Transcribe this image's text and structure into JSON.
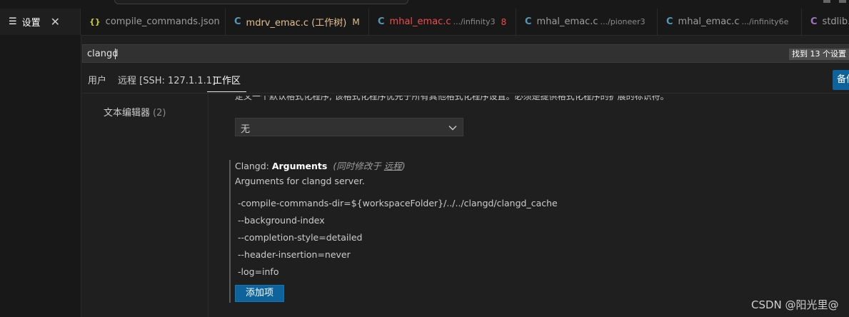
{
  "tabs": [
    {
      "icon": "{}",
      "icon_name": "json-file-icon",
      "label": "compile_commands.json",
      "desc": "",
      "badge": ""
    },
    {
      "icon": "C",
      "icon_name": "c-file-icon",
      "label": "mdrv_emac.c (工作树)",
      "desc": "",
      "badge": "M"
    },
    {
      "icon": "C",
      "icon_name": "c-file-icon",
      "label": "mhal_emac.c",
      "desc": ".../infinity3",
      "badge": "8"
    },
    {
      "icon": "C",
      "icon_name": "c-file-icon",
      "label": "mhal_emac.c",
      "desc": ".../pioneer3",
      "badge": ""
    },
    {
      "icon": "C",
      "icon_name": "c-file-icon",
      "label": "mhal_emac.c",
      "desc": ".../infinity6e",
      "badge": ""
    },
    {
      "icon": "C",
      "icon_name": "h-file-icon",
      "label": "stdlib.h",
      "desc": "",
      "badge": ""
    }
  ],
  "settings_tab": {
    "icon_name": "settings-editor-icon",
    "label": "设置",
    "close": "✕"
  },
  "search": {
    "value": "clangd",
    "result_count": "找到 13 个设置"
  },
  "scopes": {
    "user": "用户",
    "remote": "远程 [SSH: 127.1.1.1]",
    "workspace": "工作区",
    "active": "workspace"
  },
  "backup_button": "备份和同步设置",
  "toc": {
    "label": "文本编辑器",
    "count": "(2)"
  },
  "formatter": {
    "desc": "定义一个默认格式化程序, 该格式化程序优先于所有其他格式化程序设置。必须是提供格式化程序的扩展的标识符。",
    "selected": "无"
  },
  "setting": {
    "category": "Clangd: ",
    "name": "Arguments",
    "modified_prefix": "(同时修改于 ",
    "modified_link": "远程",
    "modified_suffix": ")",
    "description": "Arguments for clangd server.",
    "args": [
      "-compile-commands-dir=${workspaceFolder}/../../clangd/clangd_cache",
      "--background-index",
      "--completion-style=detailed",
      "--header-insertion=never",
      "-log=info"
    ],
    "add_label": "添加项"
  },
  "watermark": "CSDN @阳光里@",
  "colors": {
    "accent": "#0e639c",
    "modified": "#e2c08d",
    "error": "#f14c4c",
    "c_icon": "#519aba",
    "json_icon": "#cbcb41"
  }
}
